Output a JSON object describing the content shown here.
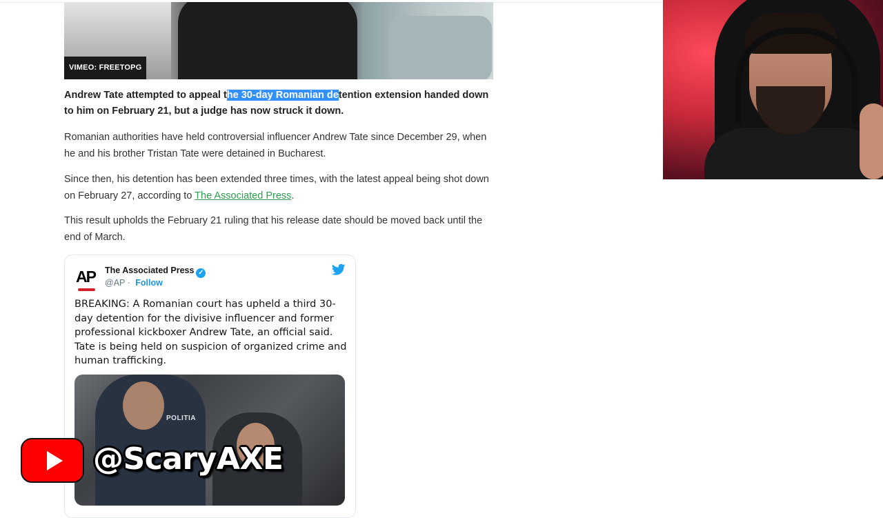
{
  "article": {
    "image_credit": "VIMEO: FREETOPG",
    "lead": {
      "before": "Andrew Tate attempted to appeal t",
      "selected": "he 30-day Romanian de",
      "after": "tention extension handed down to him on February 21, but a judge has now struck it down."
    },
    "paragraphs": [
      {
        "text": "Romanian authorities have held controversial influencer Andrew Tate since December 29, when he and his brother Tristan Tate were detained in Bucharest."
      },
      {
        "before": "Since then, his detention has been extended three times, with the latest appeal being shot down on February 27, according to ",
        "link": "The Associated Press",
        "after": "."
      },
      {
        "text": "This result upholds the February 21 ruling that his release date should be moved back until the end of March."
      }
    ]
  },
  "tweet": {
    "logo": "AP",
    "author": "The Associated Press",
    "handle": "@AP",
    "follow_label": "Follow",
    "verified_icon": "verified-check-icon",
    "platform_icon": "twitter-bird-icon",
    "text": "BREAKING: A Romanian court has upheld a third 30-day detention for the divisive influencer and former professional kickboxer Andrew Tate, an official said. Tate is being held on suspicion of organized crime and human trafficking.",
    "image_badge": "POLITIA"
  },
  "overlay": {
    "channel_handle": "@ScaryAXE",
    "youtube_icon": "youtube-play-icon",
    "colors": {
      "youtube_red": "#ff0000",
      "link_green": "#2e9d4e",
      "selection_blue": "#3390ff",
      "twitter_blue": "#1da1f2"
    }
  }
}
